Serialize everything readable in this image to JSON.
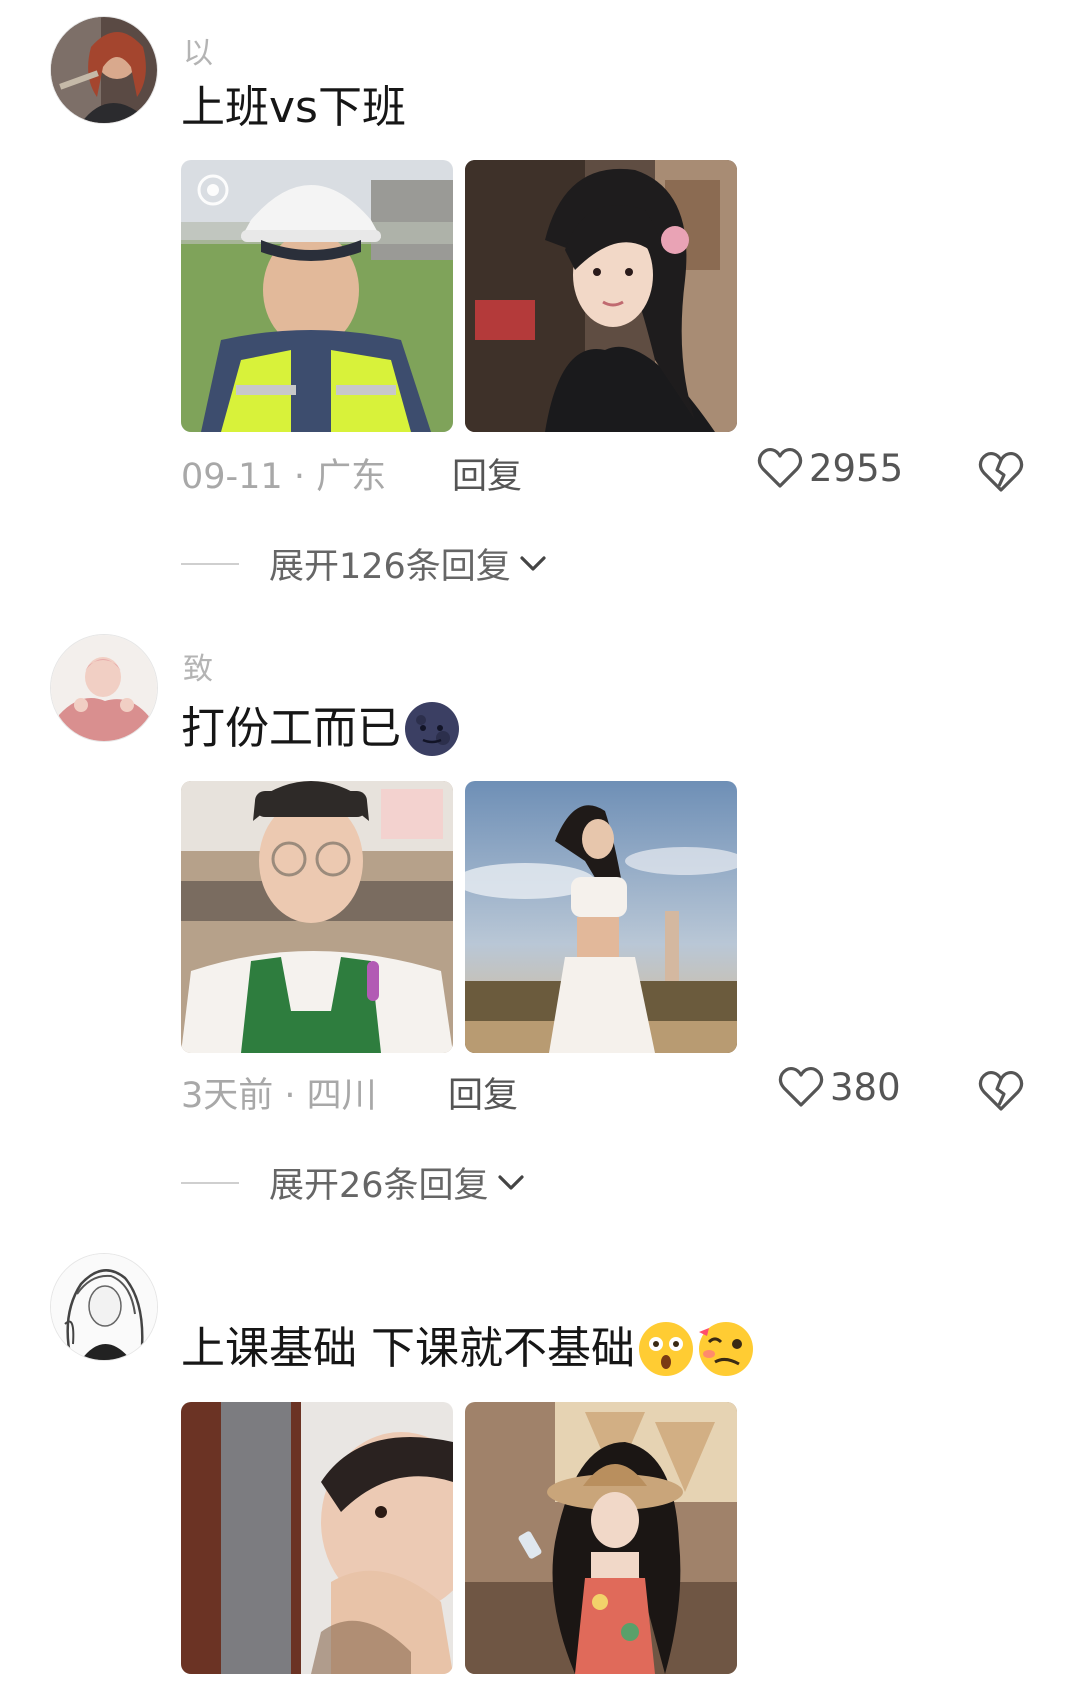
{
  "comments": [
    {
      "username": "以",
      "text": "上班vs下班",
      "date_location": "09-11 · 广东",
      "reply_label": "回复",
      "likes": "2955",
      "expand_label": "展开126条回复",
      "photos": [
        "selfie-hard-hat-safety-vest",
        "woman-in-black-dress-flower-hair"
      ]
    },
    {
      "username": "致",
      "text": "打份工而已",
      "emoji": "dark-moon-face-emoji",
      "date_location": "3天前 · 四川",
      "reply_label": "回复",
      "likes": "380",
      "expand_label": "展开26条回复",
      "photos": [
        "selfie-glasses-green-apron",
        "woman-white-crop-top-sunset"
      ]
    },
    {
      "username": "",
      "text": "上课基础 下课就不基础",
      "emoji": [
        "astonished-face-emoji",
        "woozy-face-emoji"
      ],
      "photos": [
        "selfie-close-up-hand-on-face",
        "woman-straw-hat-floral-dress"
      ]
    }
  ],
  "icons": {
    "like": "heart-outline-icon",
    "dislike": "broken-heart-icon",
    "expand": "chevron-down-icon"
  }
}
